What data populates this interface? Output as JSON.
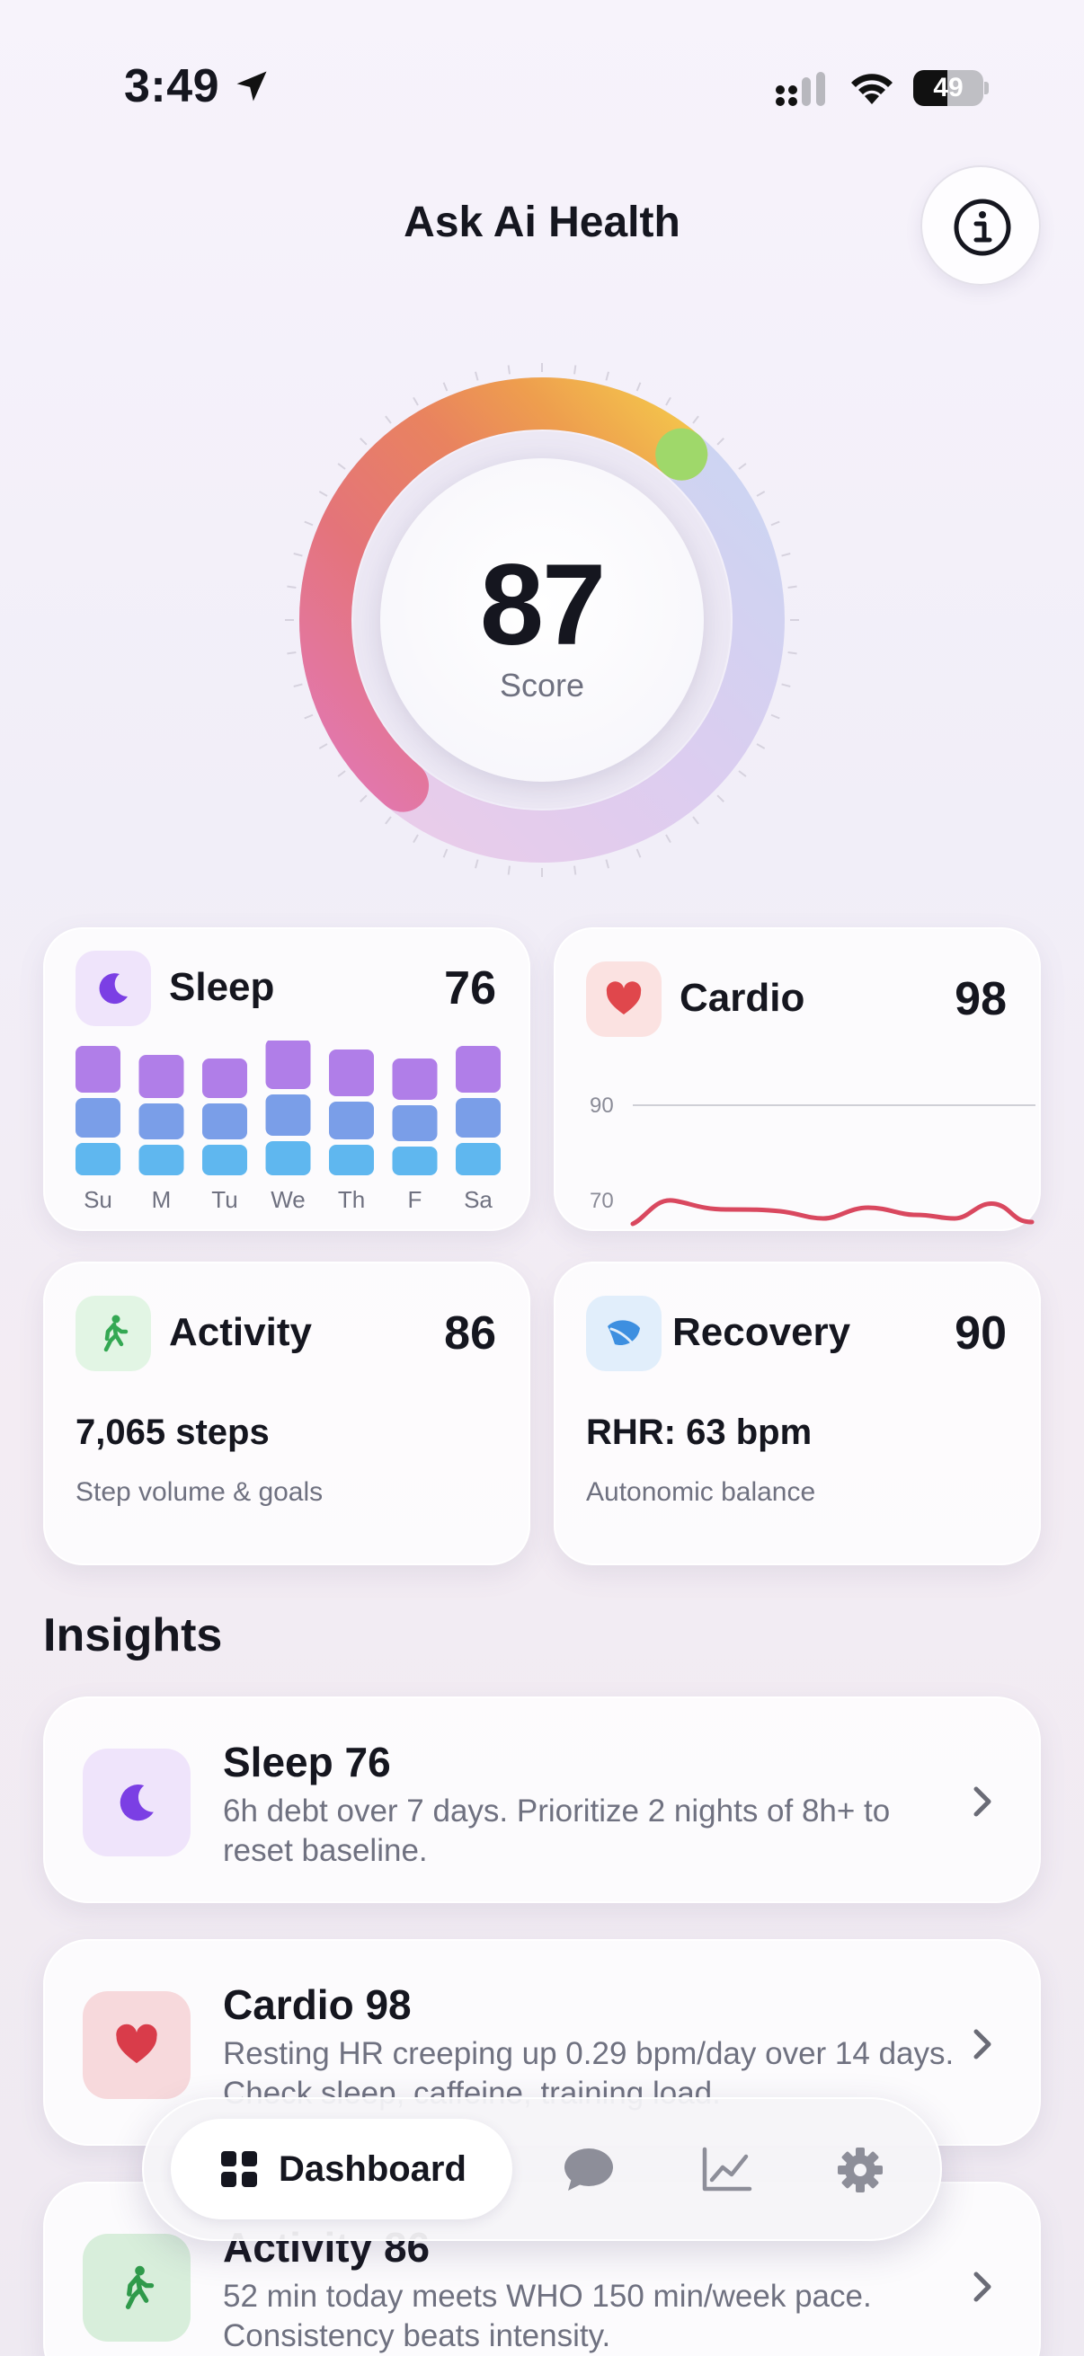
{
  "status_bar": {
    "time": "3:49",
    "battery": "49",
    "battery_level": 0.49,
    "icons": [
      "location-arrow-icon",
      "cellular-signal-icon",
      "wifi-icon",
      "battery-icon"
    ]
  },
  "header": {
    "title": "Ask Ai Health",
    "info_icon": "info-icon"
  },
  "score": {
    "value": "87",
    "label": "Score",
    "fraction": 0.87
  },
  "cards": {
    "sleep": {
      "title": "Sleep",
      "value": "76",
      "icon": "moon-icon",
      "accent": "#7b3fe4",
      "days": [
        "Su",
        "M",
        "Tu",
        "We",
        "Th",
        "F",
        "Sa"
      ],
      "chart_colors": [
        "#b07ee8",
        "#7a9ee8",
        "#5fb7ef"
      ]
    },
    "cardio": {
      "title": "Cardio",
      "value": "98",
      "icon": "heart-icon",
      "accent": "#e0474c",
      "y_ticks": [
        "90",
        "70"
      ],
      "line_color": "#d9485f"
    },
    "activity": {
      "title": "Activity",
      "value": "86",
      "icon": "walking-icon",
      "accent": "#34a853",
      "main": "7,065 steps",
      "sub": "Step volume & goals"
    },
    "recovery": {
      "title": "Recovery",
      "value": "90",
      "icon": "leaf-icon",
      "accent": "#3d8fe0",
      "main": "RHR: 63 bpm",
      "sub": "Autonomic balance"
    }
  },
  "insights": {
    "title": "Insights",
    "items": [
      {
        "title": "Sleep 76",
        "desc": "6h debt over 7 days. Prioritize 2 nights of 8h+ to reset baseline.",
        "icon": "moon-icon"
      },
      {
        "title": "Cardio 98",
        "desc": "Resting HR creeping up 0.29 bpm/day over 14 days. Check sleep, caffeine, training load.",
        "icon": "heart-icon"
      },
      {
        "title": "Activity 86",
        "desc": "52 min today meets WHO 150 min/week pace. Consistency beats intensity.",
        "icon": "walking-icon"
      }
    ]
  },
  "tab_bar": {
    "active_label": "Dashboard",
    "tabs": [
      "dashboard-grid-icon",
      "chat-bubble-icon",
      "trend-chart-icon",
      "gear-icon"
    ]
  }
}
